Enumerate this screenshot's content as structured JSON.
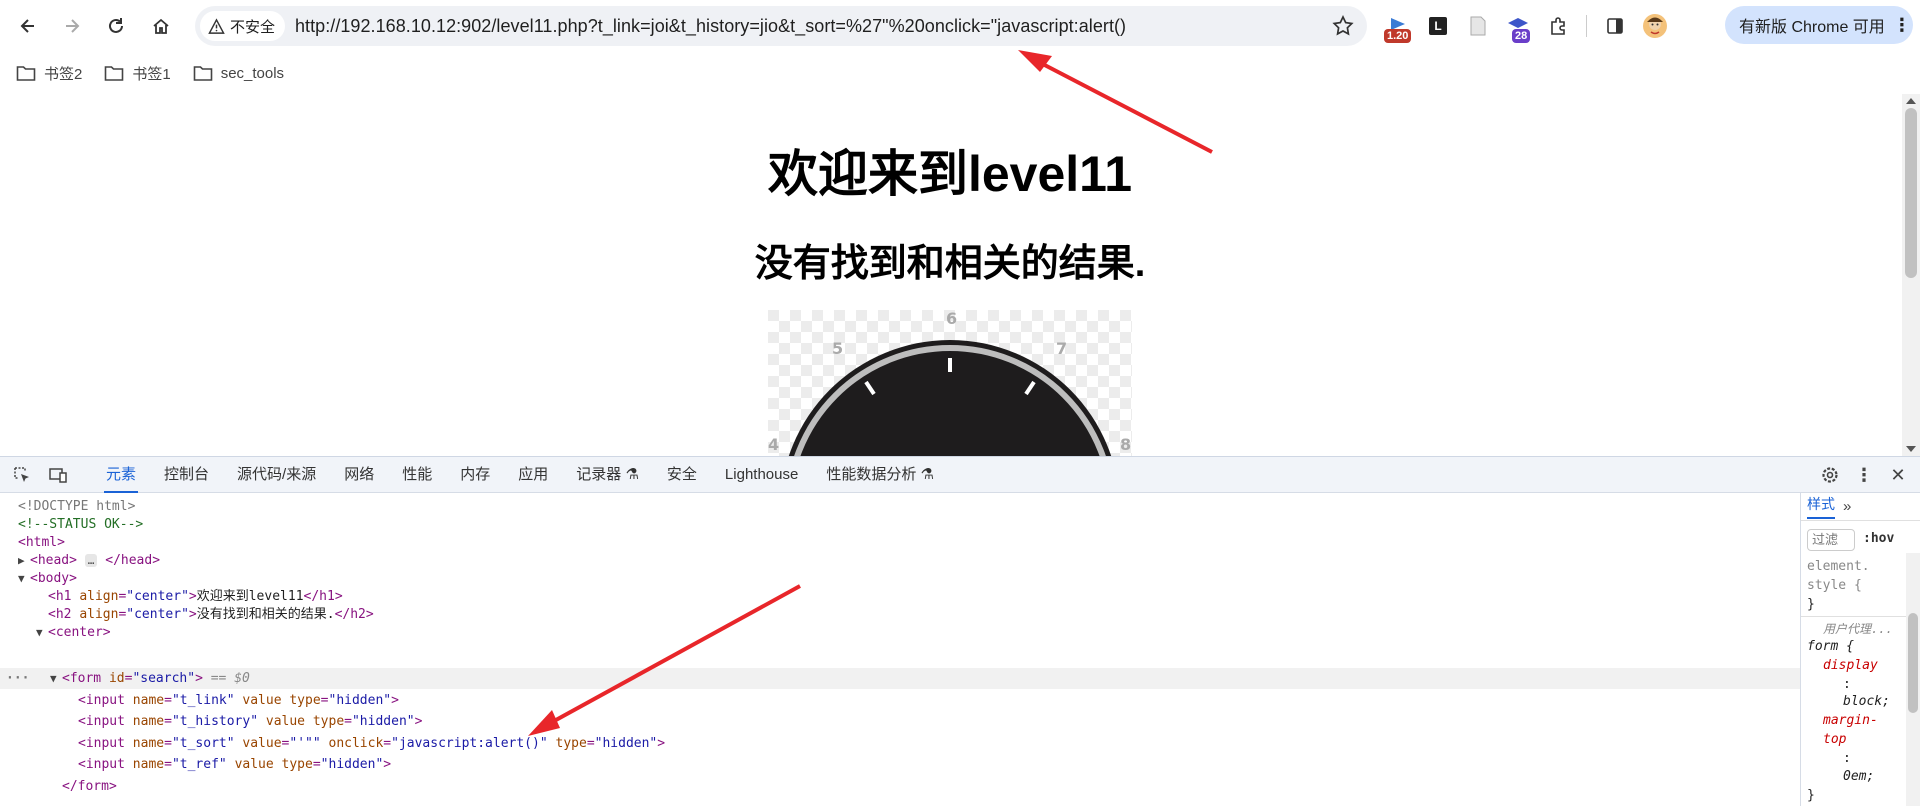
{
  "browser": {
    "security_label": "不安全",
    "url": "http://192.168.10.12:902/level11.php?t_link=joi&t_history=jio&t_sort=%27\"%20onclick=\"javascript:alert()",
    "extensions": [
      {
        "name": "ext-badge-icon",
        "badge": "1.20"
      },
      {
        "name": "ext-l-icon",
        "badge": ""
      },
      {
        "name": "ext-doc-icon",
        "badge": ""
      },
      {
        "name": "ext-hat-icon",
        "badge": "28"
      },
      {
        "name": "extensions-puzzle-icon",
        "badge": ""
      }
    ],
    "update_label": "有新版 Chrome 可用"
  },
  "bookmarks": [
    {
      "label": "书签2"
    },
    {
      "label": "书签1"
    },
    {
      "label": "sec_tools"
    }
  ],
  "page": {
    "h1": "欢迎来到level11",
    "h2": "没有找到和相关的结果."
  },
  "devtools": {
    "tabs": [
      "元素",
      "控制台",
      "源代码/来源",
      "网络",
      "性能",
      "内存",
      "应用",
      "记录器",
      "安全",
      "Lighthouse",
      "性能数据分析"
    ],
    "active_tab": "元素",
    "styles_tab": "样式",
    "filter_placeholder": "过滤",
    "hov_label": ":hov",
    "dom": {
      "doctype": "<!DOCTYPE html>",
      "comment": "<!--STATUS OK-->",
      "h1_text": "欢迎来到level11",
      "h2_text": "没有找到和相关的结果.",
      "selected_marker": "== $0",
      "inputs": [
        {
          "name": "t_link"
        },
        {
          "name": "t_history"
        },
        {
          "name": "t_sort",
          "value": "'\"",
          "onclick": "javascript:alert()"
        },
        {
          "name": "t_ref"
        }
      ]
    },
    "styles": {
      "element_style": "element.\nstyle {",
      "close_brace": "}",
      "user_agent_label": "用户代理...",
      "form_selector": "form {",
      "display_prop": "display",
      "display_val": "block;",
      "margin_prop": "margin-\ntop",
      "margin_val": "0em;"
    }
  }
}
